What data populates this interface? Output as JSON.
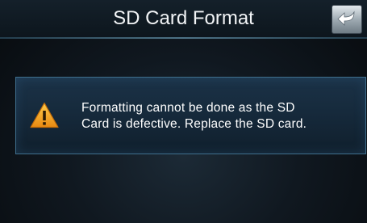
{
  "header": {
    "title": "SD Card Format",
    "back_icon": "back-arrow-icon"
  },
  "dialog": {
    "icon": "warning-icon",
    "message_lines": [
      "Formatting cannot be done as the SD",
      "Card is defective. Replace the SD card."
    ]
  },
  "colors": {
    "background": "#101820",
    "dialog_border": "#3f6f8d",
    "warning": "#f0a020"
  }
}
